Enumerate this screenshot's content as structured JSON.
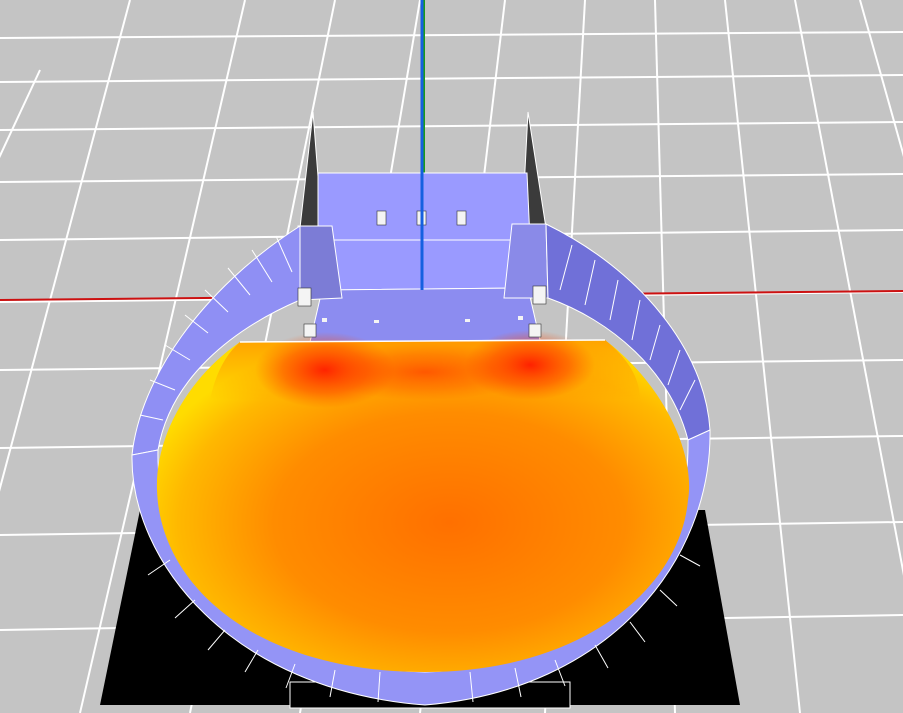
{
  "viewport": {
    "name": "3d-viewport",
    "background_color": "#c4c4c4",
    "grid_line_color": "#ffffff"
  },
  "axes": {
    "x_axis_color": "#cc1111",
    "y_axis_color": "#1a9a1a",
    "z_axis_color": "#1560e0"
  },
  "model": {
    "wall_color": "#8f8ff4",
    "wall_shade_color": "#6b6bd4",
    "stage_color": "#9a9aff",
    "stage_shade_color": "#7c7cd6",
    "base_color": "#000000",
    "spike_color": "#3b3b3b",
    "speaker_color": "#f4f4f4",
    "heatmap_colors": [
      "#ffe800",
      "#ffb000",
      "#ff7a00",
      "#ff3a00",
      "#ff1a00"
    ]
  }
}
